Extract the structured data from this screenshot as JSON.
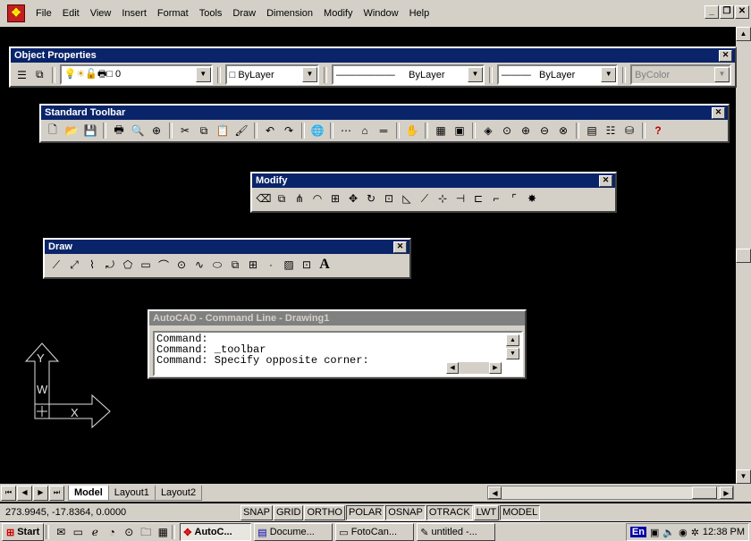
{
  "menu": [
    "File",
    "Edit",
    "View",
    "Insert",
    "Format",
    "Tools",
    "Draw",
    "Dimension",
    "Modify",
    "Window",
    "Help"
  ],
  "window_buttons": {
    "minimize": "_",
    "restore": "❐",
    "close": "✕"
  },
  "object_properties": {
    "title": "Object Properties",
    "layer": "0",
    "color": "ByLayer",
    "linetype": "ByLayer",
    "lineweight": "ByLayer",
    "plotstyle": "ByColor"
  },
  "standard_toolbar": {
    "title": "Standard Toolbar"
  },
  "modify_toolbar": {
    "title": "Modify"
  },
  "draw_toolbar": {
    "title": "Draw",
    "text_tool": "A"
  },
  "command_line": {
    "title": "AutoCAD - Command Line - Drawing1",
    "lines": [
      "Command:",
      "Command: _toolbar",
      "Command: Specify opposite corner:"
    ]
  },
  "ucs": {
    "y": "Y",
    "x": "X",
    "w": "W"
  },
  "layout_tabs": [
    "Model",
    "Layout1",
    "Layout2"
  ],
  "status": {
    "coords": "273.9945, -17.8364, 0.0000",
    "toggles": [
      "SNAP",
      "GRID",
      "ORTHO",
      "POLAR",
      "OSNAP",
      "OTRACK",
      "LWT",
      "MODEL"
    ]
  },
  "taskbar": {
    "start": "Start",
    "tasks": [
      "AutoC...",
      "Docume...",
      "FotoCan...",
      "untitled -..."
    ],
    "language": "En",
    "clock": "12:38 PM"
  }
}
